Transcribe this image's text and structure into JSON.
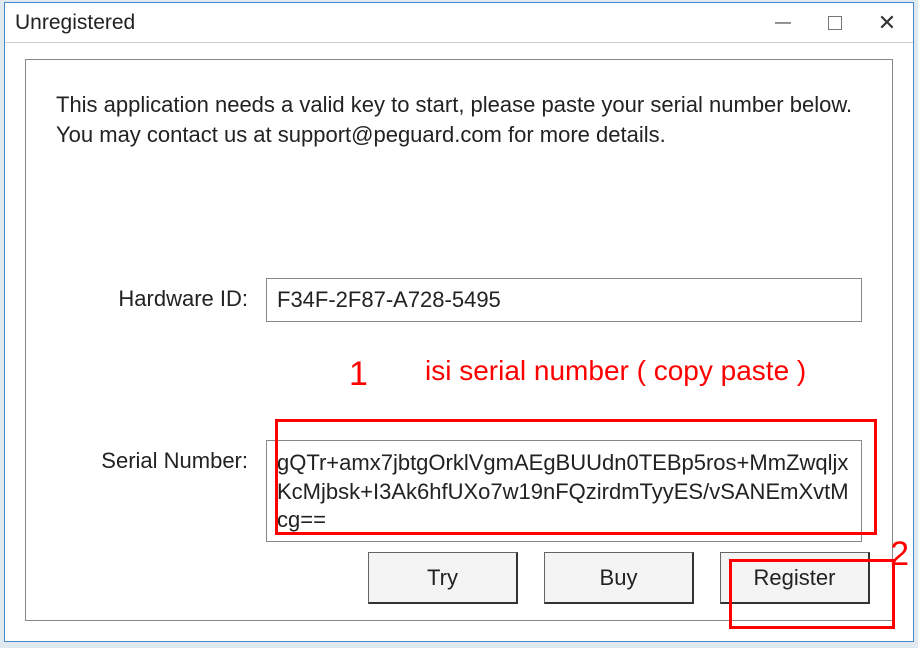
{
  "window": {
    "title": "Unregistered"
  },
  "instruction": "This application needs a valid key to start, please paste your serial number below. You may contact us at support@peguard.com for more details.",
  "labels": {
    "hardware_id": "Hardware ID:",
    "serial_number": "Serial Number:"
  },
  "fields": {
    "hardware_id": "F34F-2F87-A728-5495",
    "serial_number": "gQTr+amx7jbtgOrklVgmAEgBUUdn0TEBp5ros+MmZwqljxKcMjbsk+I3Ak6hfUXo7w19nFQzirdmTyyES/vSANEmXvtMcg=="
  },
  "buttons": {
    "try": "Try",
    "buy": "Buy",
    "register": "Register"
  },
  "annotations": {
    "step1_num": "1",
    "step1_text": "isi serial number ( copy paste )",
    "step2_num": "2"
  }
}
